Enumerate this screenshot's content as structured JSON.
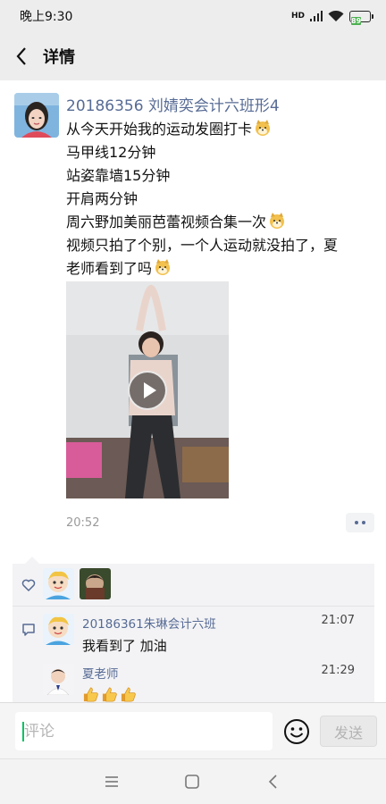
{
  "status_bar": {
    "time": "晚上9:30",
    "network": "HD",
    "battery": "89"
  },
  "header": {
    "title": "详情"
  },
  "post": {
    "author": "20186356 刘婧奕会计六班形4",
    "lines": [
      "从今天开始我的运动发圈打卡",
      "马甲线12分钟",
      "站姿靠墙15分钟",
      "开肩两分钟",
      "周六野加美丽芭蕾视频合集一次",
      "视频只拍了个别，一个人运动就没拍了，夏",
      "老师看到了吗"
    ],
    "time": "20:52"
  },
  "comments": [
    {
      "author": "20186361朱琳会计六班",
      "time": "21:07",
      "text": "我看到了 加油"
    },
    {
      "author": "夏老师",
      "time": "21:29",
      "text": ""
    }
  ],
  "input": {
    "placeholder": "评论",
    "send_label": "发送"
  },
  "colors": {
    "link_blue": "#576b95",
    "wechat_green": "#07c160",
    "panel_gray": "#f3f3f5"
  },
  "icons": [
    "back-arrow-icon",
    "heart-icon",
    "comment-icon",
    "emoji-icon",
    "play-icon",
    "dog-emoji-icon",
    "thumbs-up-icon",
    "menu-icon",
    "home-icon",
    "back-icon"
  ]
}
